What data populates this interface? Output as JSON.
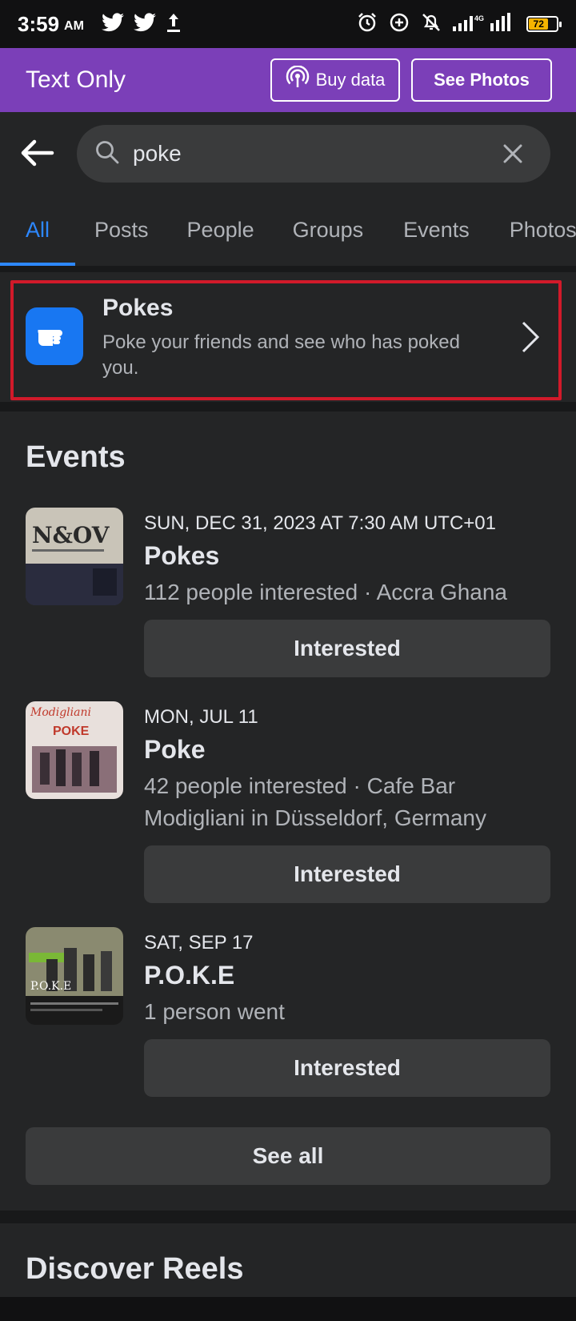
{
  "status_bar": {
    "time": "3:59",
    "ampm": "AM",
    "network": "4G",
    "battery": "72"
  },
  "text_only_bar": {
    "title": "Text Only",
    "buy_data_label": "Buy data",
    "see_photos_label": "See Photos"
  },
  "search": {
    "query": "poke"
  },
  "tabs": [
    {
      "label": "All",
      "active": true
    },
    {
      "label": "Posts"
    },
    {
      "label": "People"
    },
    {
      "label": "Groups"
    },
    {
      "label": "Events"
    },
    {
      "label": "Photos"
    }
  ],
  "pokes_card": {
    "title": "Pokes",
    "description": "Poke your friends and see who has poked you."
  },
  "events": {
    "title": "Events",
    "items": [
      {
        "date": "SUN, DEC 31, 2023 AT 7:30 AM UTC+01",
        "name": "Pokes",
        "meta": "112 people interested · Accra Ghana",
        "button_label": "Interested"
      },
      {
        "date": "MON, JUL 11",
        "name": "Poke",
        "meta": "42 people interested · Cafe  Bar Modigliani in Düsseldorf, Germany",
        "button_label": "Interested"
      },
      {
        "date": "SAT, SEP 17",
        "name": "P.O.K.E",
        "meta": "1 person went",
        "button_label": "Interested"
      }
    ],
    "see_all_label": "See all"
  },
  "reels": {
    "title": "Discover Reels"
  },
  "colors": {
    "accent": "#2d88ff",
    "purple_bar": "#7b3fb8",
    "highlight": "#d11a2a",
    "pokes_icon_bg": "#1877f2"
  }
}
